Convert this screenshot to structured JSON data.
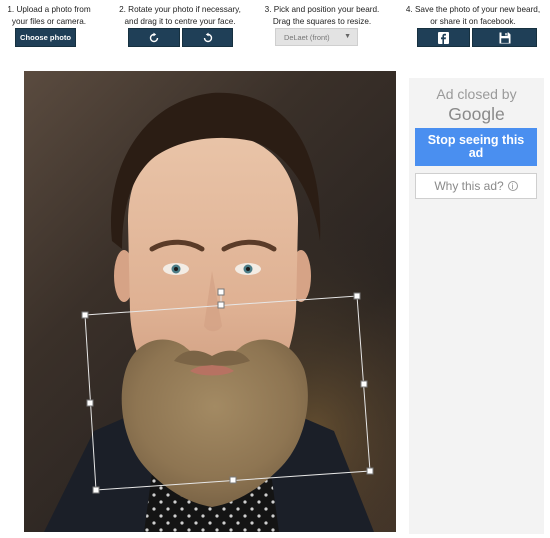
{
  "steps": [
    {
      "title": "1. Upload a photo from\nyour files or camera."
    },
    {
      "title": "2. Rotate your photo if necessary,\nand drag it to centre your face."
    },
    {
      "title": "3. Pick and position your beard.\nDrag the squares to resize."
    },
    {
      "title": "4. Save the photo of your new beard,\nor share it on facebook."
    }
  ],
  "buttons": {
    "choose_photo": "Choose photo",
    "rotate_cw_icon": "rotate-clockwise-icon",
    "rotate_ccw_icon": "rotate-counterclockwise-icon",
    "facebook_icon": "facebook-icon",
    "save_icon": "floppy-disk-icon"
  },
  "beard_select": {
    "selected": "DeLaet (front)"
  },
  "ad": {
    "closed_by": "Ad closed by",
    "brand": "Google",
    "stop_label": "Stop seeing this ad",
    "why_label": "Why this ad?"
  },
  "colors": {
    "button_dark": "#1f3f57",
    "ad_blue": "#4a8ff0",
    "ad_bg": "#f3f3f3"
  }
}
